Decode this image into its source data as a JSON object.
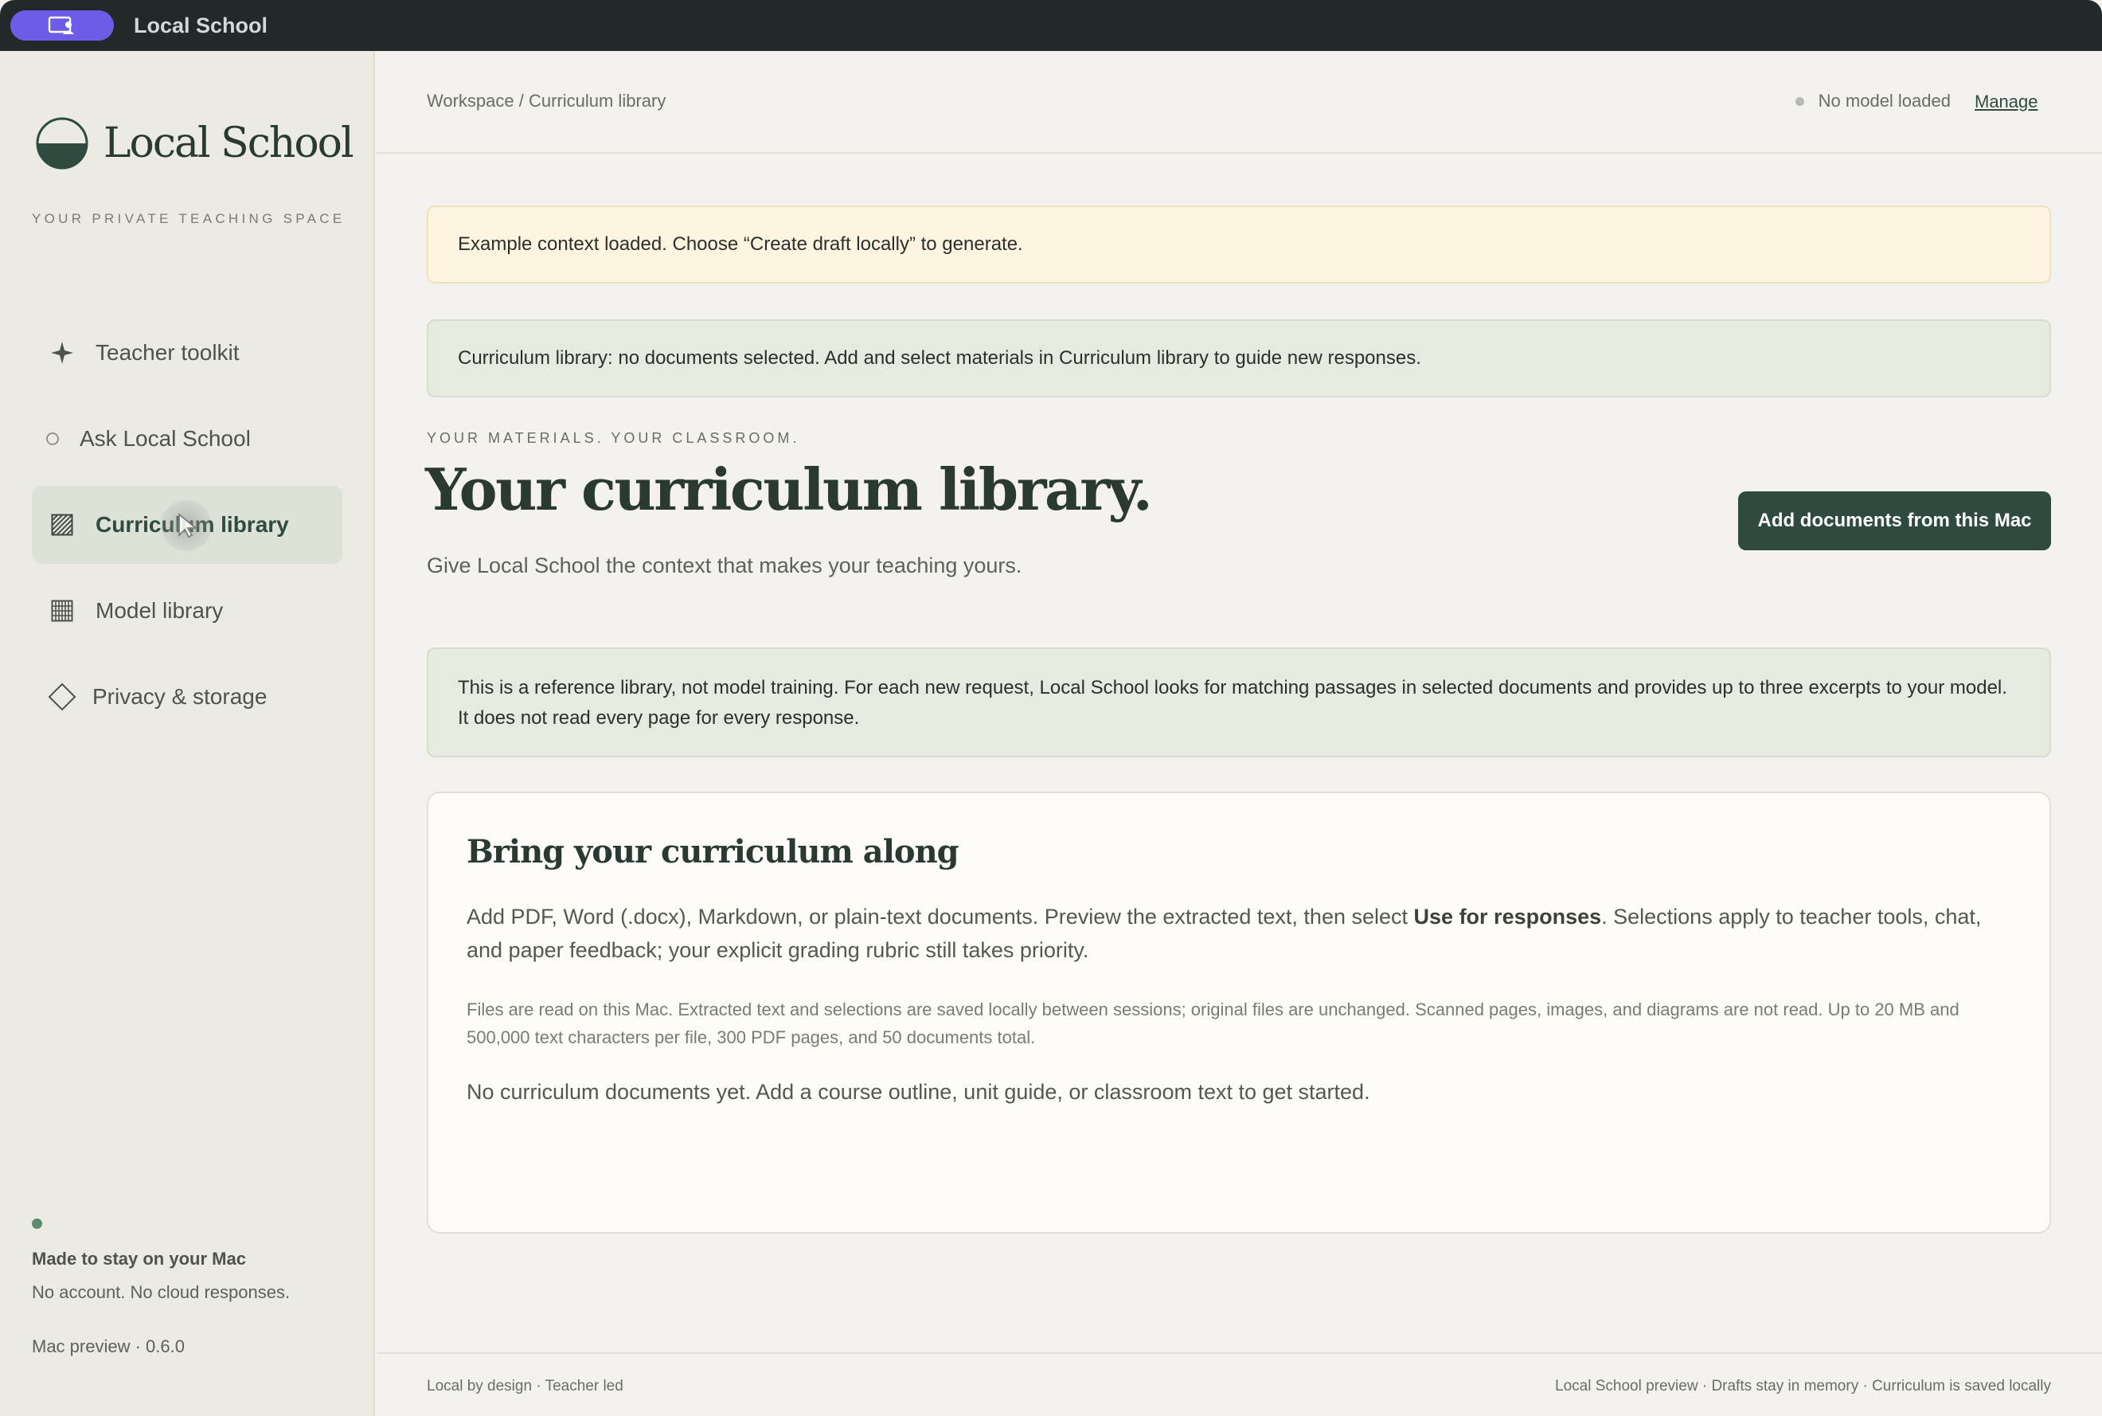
{
  "app": {
    "window_title": "Local School",
    "accent_color": "#6c5ce7",
    "brand_color": "#2f4a3e"
  },
  "sidebar": {
    "brand_name": "Local School",
    "tagline": "YOUR PRIVATE TEACHING SPACE",
    "items": [
      {
        "label": "Teacher toolkit",
        "icon": "sparkle-icon"
      },
      {
        "label": "Ask Local School",
        "icon": "circle-icon"
      },
      {
        "label": "Curriculum library",
        "icon": "hatched-square-icon",
        "active": true
      },
      {
        "label": "Model library",
        "icon": "grid-square-icon"
      },
      {
        "label": "Privacy & storage",
        "icon": "diamond-icon"
      }
    ],
    "footer": {
      "heading": "Made to stay on your Mac",
      "subtext": "No account. No cloud responses.",
      "version": "Mac preview · 0.6.0"
    }
  },
  "topbar": {
    "breadcrumb": "Workspace / Curriculum library",
    "model_status": "No model loaded",
    "manage_label": "Manage"
  },
  "banners": {
    "warning": "Example context loaded. Choose “Create draft locally” to generate.",
    "info": "Curriculum library: no documents selected. Add and select materials in Curriculum library to guide new responses."
  },
  "header": {
    "eyebrow": "YOUR MATERIALS. YOUR CLASSROOM.",
    "title": "Your curriculum library.",
    "subtitle": "Give Local School the context that makes your teaching yours.",
    "add_button": "Add documents from this Mac"
  },
  "note": "This is a reference library, not model training. For each new request, Local School looks for matching passages in selected documents and provides up to three excerpts to your model. It does not read every page for every response.",
  "card": {
    "title": "Bring your curriculum along",
    "body_before": "Add PDF, Word (.docx), Markdown, or plain-text documents. Preview the extracted text, then select ",
    "body_strong": "Use for responses",
    "body_after": ". Selections apply to teacher tools, chat, and paper feedback; your explicit grading rubric still takes priority.",
    "fine_print": "Files are read on this Mac. Extracted text and selections are saved locally between sessions; original files are unchanged. Scanned pages, images, and diagrams are not read. Up to 20 MB and 500,000 text characters per file, 300 PDF pages, and 50 documents total.",
    "empty_state": "No curriculum documents yet. Add a course outline, unit guide, or classroom text to get started."
  },
  "footer": {
    "left": "Local by design · Teacher led",
    "right": "Local School preview · Drafts stay in memory · Curriculum is saved locally"
  }
}
